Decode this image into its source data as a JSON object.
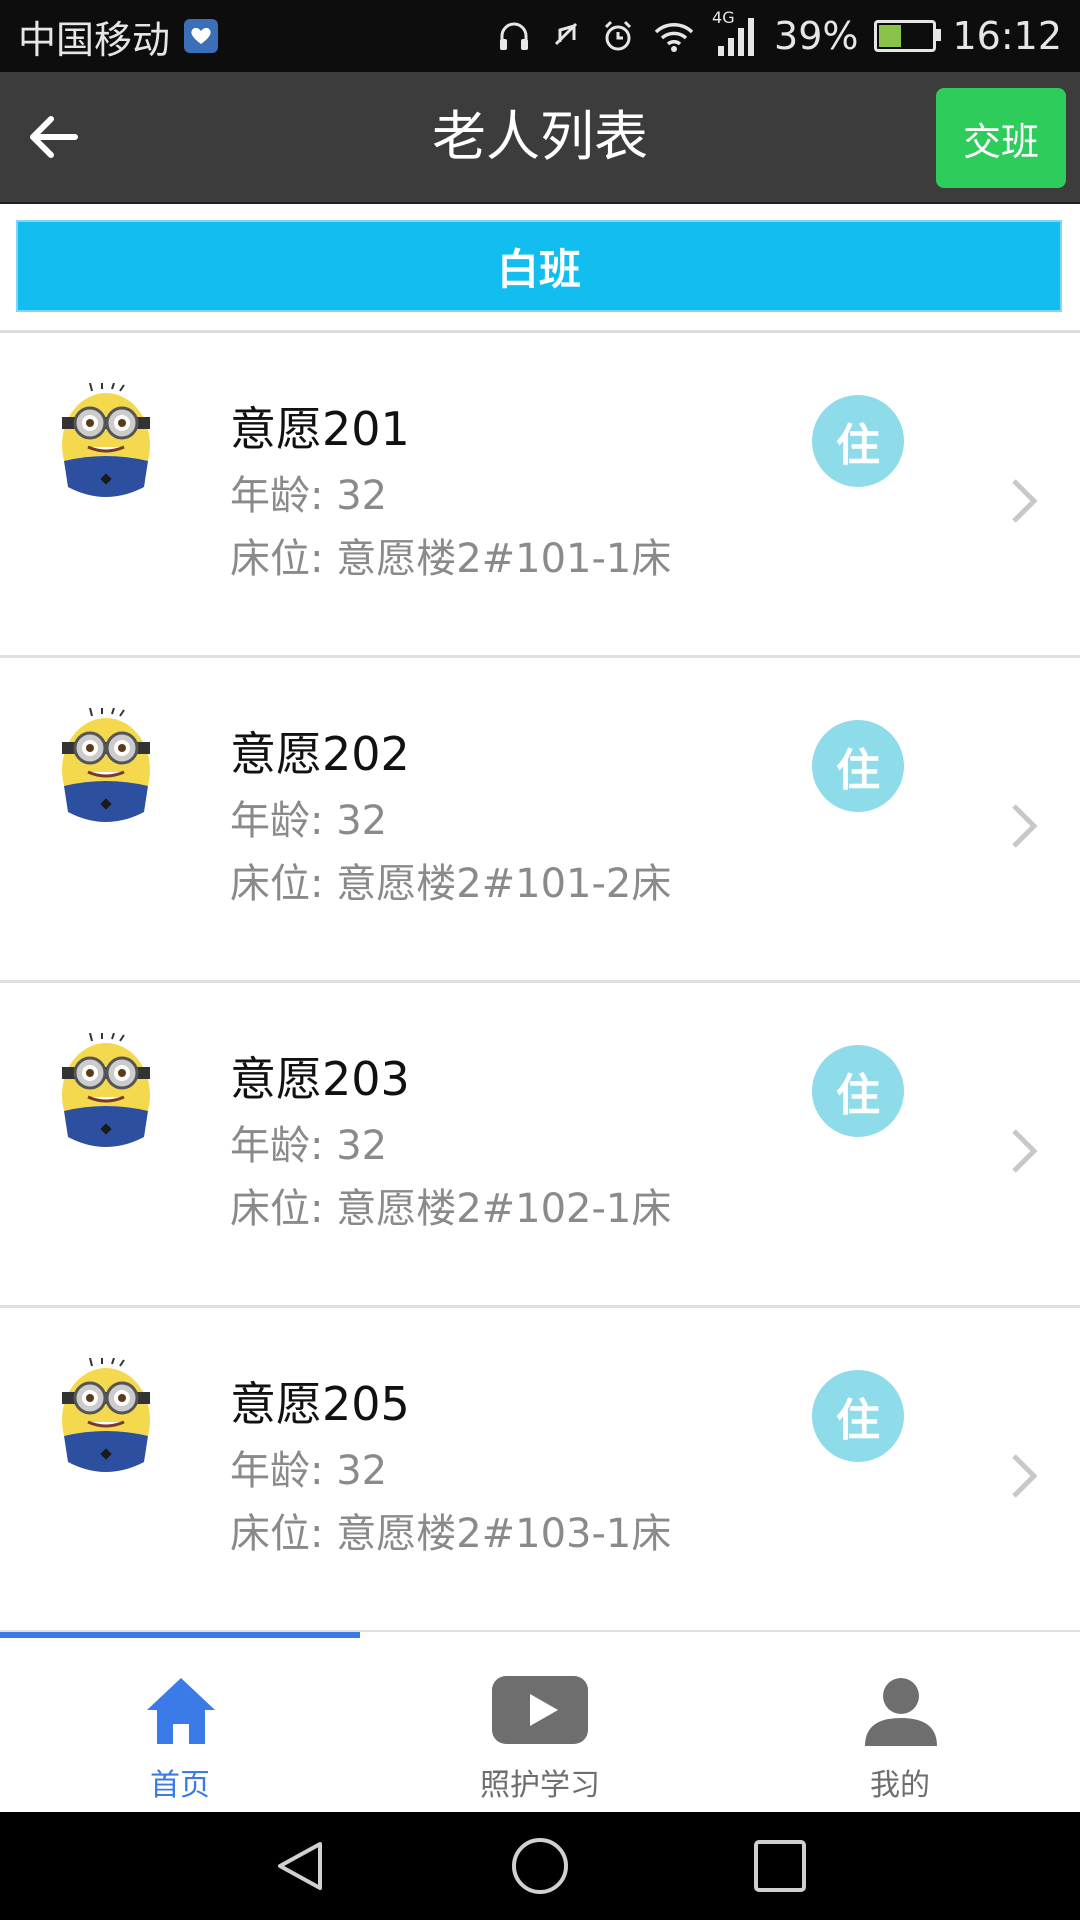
{
  "status_bar": {
    "carrier": "中国移动",
    "network": "4G",
    "battery": "39%",
    "battery_level": 0.39,
    "time": "16:12"
  },
  "header": {
    "title": "老人列表",
    "action_label": "交班"
  },
  "shift": {
    "label": "白班"
  },
  "residents": [
    {
      "name": "意愿201",
      "age_label": "年龄:  32",
      "bed_label": "床位:  意愿楼2#101-1床",
      "status": "住"
    },
    {
      "name": "意愿202",
      "age_label": "年龄:  32",
      "bed_label": "床位:  意愿楼2#101-2床",
      "status": "住"
    },
    {
      "name": "意愿203",
      "age_label": "年龄:  32",
      "bed_label": "床位:  意愿楼2#102-1床",
      "status": "住"
    },
    {
      "name": "意愿205",
      "age_label": "年龄:  32",
      "bed_label": "床位:  意愿楼2#103-1床",
      "status": "住"
    }
  ],
  "tabs": [
    {
      "label": "首页",
      "icon": "home-icon",
      "active": true
    },
    {
      "label": "照护学习",
      "icon": "play-video-icon",
      "active": false
    },
    {
      "label": "我的",
      "icon": "person-icon",
      "active": false
    }
  ],
  "colors": {
    "header_bg": "#3c3c3c",
    "handover_green": "#2ecc5b",
    "shift_blue": "#12bdf0",
    "badge_cyan": "#8edcea",
    "tab_active": "#3a7be8",
    "tab_inactive": "#6e6e6e"
  }
}
